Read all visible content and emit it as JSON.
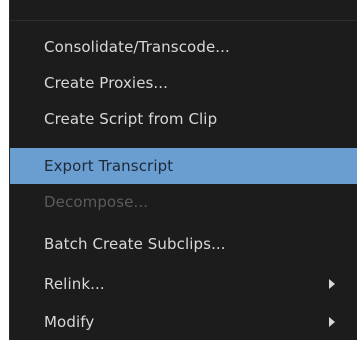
{
  "menu": {
    "items": [
      {
        "label": "Consolidate/Transcode...",
        "state": "normal",
        "submenu": false
      },
      {
        "label": "Create Proxies...",
        "state": "normal",
        "submenu": false
      },
      {
        "label": "Create Script from Clip",
        "state": "normal",
        "submenu": false
      },
      {
        "label": "Export Transcript",
        "state": "highlighted",
        "submenu": false
      },
      {
        "label": "Decompose...",
        "state": "disabled",
        "submenu": false
      },
      {
        "label": "Batch Create Subclips...",
        "state": "normal",
        "submenu": false
      },
      {
        "label": "Relink...",
        "state": "normal",
        "submenu": true,
        "submenu_icon": "triangle-right-icon"
      },
      {
        "label": "Modify",
        "state": "normal",
        "submenu": true,
        "submenu_icon": "triangle-right-icon"
      }
    ]
  },
  "colors": {
    "menu_background": "#1c1c1c",
    "highlight": "#6a9dd0",
    "text": "#d8d8d8",
    "disabled_text": "#5b5b5b"
  }
}
